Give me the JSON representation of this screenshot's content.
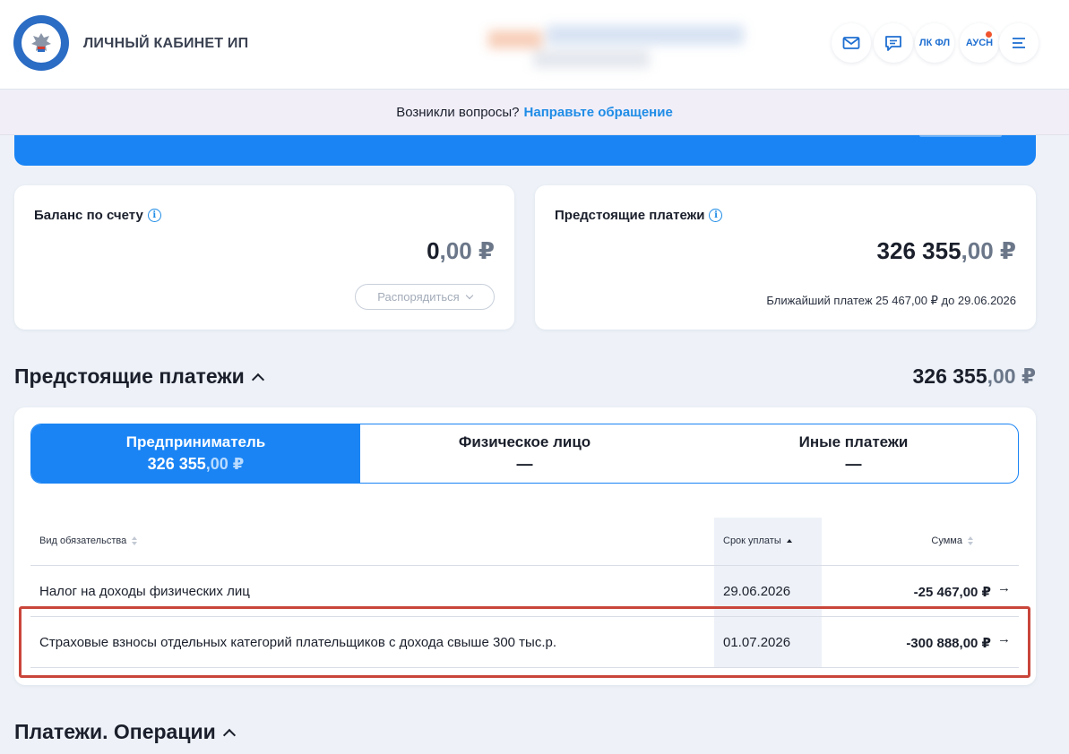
{
  "header": {
    "brand": "ЛИЧНЫЙ КАБИНЕТ ИП",
    "buttons": [
      {
        "name": "mail-icon"
      },
      {
        "name": "chat-icon"
      },
      {
        "label": "ЛК ФЛ"
      },
      {
        "label": "АУСН"
      },
      {
        "name": "menu-icon"
      }
    ]
  },
  "banner": {
    "question": "Возникли вопросы?",
    "link": "Направьте обращение"
  },
  "balance": {
    "title": "Баланс по счету",
    "amount_int": "0",
    "amount_frac": ",00 ₽",
    "button": "Распорядиться"
  },
  "upcoming_card": {
    "title": "Предстоящие платежи",
    "amount_int": "326 355",
    "amount_frac": ",00 ₽",
    "nearest": "Ближайший платеж 25 467,00 ₽ до 29.06.2026"
  },
  "upcoming_section": {
    "title": "Предстоящие платежи",
    "total_int": "326 355",
    "total_frac": ",00 ₽",
    "tabs": [
      {
        "label": "Предприниматель",
        "value_int": "326 355",
        "value_frac": ",00 ₽"
      },
      {
        "label": "Физическое лицо",
        "value": "—"
      },
      {
        "label": "Иные платежи",
        "value": "—"
      }
    ],
    "columns": {
      "type": "Вид обязательства",
      "due": "Срок уплаты",
      "sum": "Сумма"
    },
    "rows": [
      {
        "type": "Налог на доходы физических лиц",
        "due": "29.06.2026",
        "sum": "-25 467,00 ₽"
      },
      {
        "type": "Страховые взносы отдельных категорий плательщиков с дохода свыше 300 тыс.р.",
        "due": "01.07.2026",
        "sum": "-300 888,00 ₽"
      }
    ]
  },
  "operations_section": {
    "title": "Платежи. Операции"
  },
  "colors": {
    "accent": "#1a84f4",
    "link": "#1f8ce6",
    "highlight": "#c9453a"
  }
}
